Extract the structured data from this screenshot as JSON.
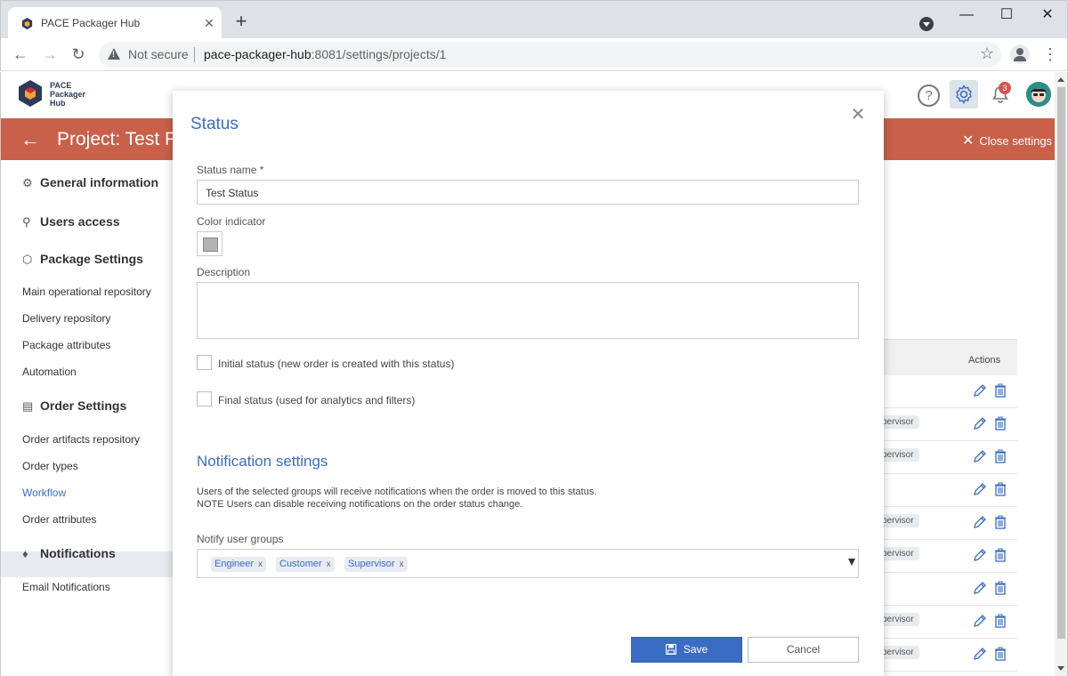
{
  "browser": {
    "tab_title": "PACE Packager Hub",
    "tab_close": "✕",
    "new_tab": "+",
    "not_secure": "Not secure",
    "url_host": "pace-packager-hub",
    "url_path": ":8081/settings/projects/1",
    "window_min": "—",
    "window_max": "☐",
    "window_close": "✕"
  },
  "app": {
    "logo_lines": [
      "PACE",
      "Packager",
      "Hub"
    ],
    "notification_count": "3",
    "help_glyph": "?",
    "project_title": "Project: Test P",
    "close_settings": "Close settings",
    "brand_color": "#3b6cc4",
    "banner_color": "#c8604a"
  },
  "sidebar": {
    "general_information": "General information",
    "users_access": "Users access",
    "package_settings": "Package Settings",
    "main_operational_repository": "Main operational repository",
    "delivery_repository": "Delivery repository",
    "package_attributes": "Package attributes",
    "automation": "Automation",
    "order_settings": "Order Settings",
    "order_artifacts_repository": "Order artifacts repository",
    "order_types": "Order types",
    "workflow": "Workflow",
    "order_attributes": "Order attributes",
    "notifications": "Notifications",
    "email_notifications": "Email Notifications"
  },
  "background_table": {
    "actions_header": "Actions",
    "row_chips": [
      "",
      "pervisor",
      "pervisor",
      "",
      "pervisor",
      "pervisor",
      "",
      "pervisor",
      "pervisor"
    ]
  },
  "modal": {
    "title": "Status",
    "close": "✕",
    "status_name_label": "Status name *",
    "status_name_value": "Test Status",
    "color_indicator_label": "Color indicator",
    "color_value": "#b3b3b3",
    "description_label": "Description",
    "initial_status_label": "Initial status (new order is created with this status)",
    "initial_status_checked": false,
    "final_status_label": "Final status (used for analytics and filters)",
    "final_status_checked": false,
    "notification_settings_title": "Notification settings",
    "note_line1": "Users of the selected groups will receive notifications when the order is moved to this status.",
    "note_line2": "NOTE Users can disable receiving notifications on the order status change.",
    "notify_groups_label": "Notify user groups",
    "groups": [
      "Engineer",
      "Customer",
      "Supervisor"
    ],
    "chip_remove": "x",
    "save_label": "Save",
    "cancel_label": "Cancel"
  }
}
